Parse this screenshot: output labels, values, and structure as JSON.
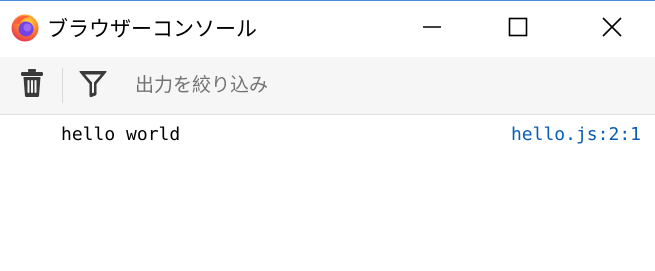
{
  "window": {
    "title": "ブラウザーコンソール",
    "app_icon": "firefox-logo-icon",
    "controls": [
      "minimize-icon",
      "maximize-icon",
      "close-icon"
    ]
  },
  "toolbar": {
    "clear_icon": "trash-icon",
    "filter_icon": "funnel-icon",
    "filter_placeholder": "出力を絞り込み",
    "filter_value": ""
  },
  "console": {
    "messages": [
      {
        "text": "hello world",
        "location": "hello.js:2:1"
      }
    ]
  },
  "colors": {
    "toolbar_bg": "#f6f6f7",
    "link": "#0a5db5",
    "window_accent": "#4a90d9"
  }
}
